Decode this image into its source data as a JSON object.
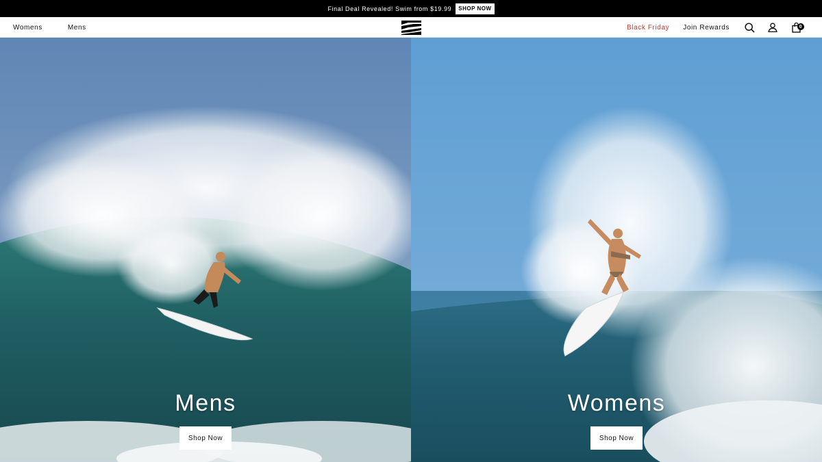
{
  "announcement": {
    "message": "Final Deal Revealed! Swim from $19.99",
    "button_label": "SHOP NOW"
  },
  "nav": {
    "left_links": [
      "Womens",
      "Mens"
    ],
    "black_friday": "Black Friday",
    "join_rewards": "Join Rewards",
    "cart_count": "0",
    "icons": [
      "logo-icon",
      "search-icon",
      "account-icon",
      "cart-icon"
    ]
  },
  "hero": {
    "panels": [
      {
        "title": "Mens",
        "cta_label": "Shop Now"
      },
      {
        "title": "Womens",
        "cta_label": "Shop Now"
      }
    ]
  },
  "colors": {
    "announcement_bg": "#000000",
    "black_friday": "#c0392b",
    "ocean_dark": "#1f5c64",
    "sky_blue": "#5b9bcf"
  }
}
